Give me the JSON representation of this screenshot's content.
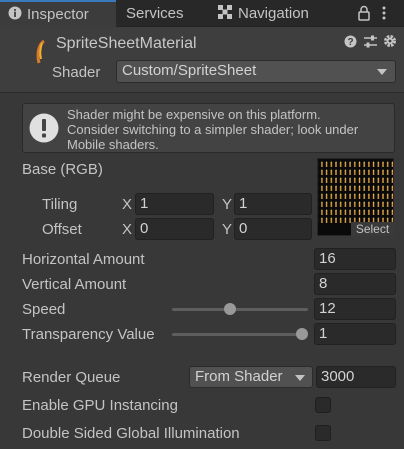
{
  "tabs": [
    {
      "label": "Inspector",
      "icon": "info-icon",
      "active": true
    },
    {
      "label": "Services",
      "icon": "",
      "active": false
    },
    {
      "label": "Navigation",
      "icon": "navigation-icon",
      "active": false
    }
  ],
  "header": {
    "material_name": "SpriteSheetMaterial",
    "shader_label": "Shader",
    "shader_value": "Custom/SpriteSheet"
  },
  "warning": {
    "text_line1": "Shader might be expensive on this platform.",
    "text_line2": "Consider switching to a simpler shader; look under",
    "text_line3": "Mobile shaders."
  },
  "base": {
    "label": "Base (RGB)",
    "tiling_label": "Tiling",
    "offset_label": "Offset",
    "x_label": "X",
    "y_label": "Y",
    "tiling_x": "1",
    "tiling_y": "1",
    "offset_x": "0",
    "offset_y": "0",
    "select_label": "Select"
  },
  "properties": {
    "horizontal_label": "Horizontal Amount",
    "horizontal_value": "16",
    "vertical_label": "Vertical Amount",
    "vertical_value": "8",
    "speed_label": "Speed",
    "speed_value": "12",
    "speed_fraction": 0.42,
    "transparency_label": "Transparency Value",
    "transparency_value": "1",
    "transparency_fraction": 1.0
  },
  "render": {
    "queue_label": "Render Queue",
    "queue_mode": "From Shader",
    "queue_value": "3000",
    "gpu_label": "Enable GPU Instancing",
    "gpu_checked": false,
    "dsgi_label": "Double Sided Global Illumination",
    "dsgi_checked": false
  },
  "colors": {
    "accent": "#3a79bb",
    "panel_bg": "#383838",
    "field_bg": "#2a2a2a"
  }
}
